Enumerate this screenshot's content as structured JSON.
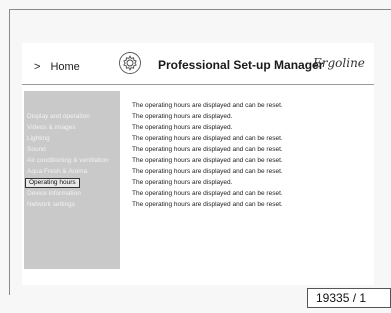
{
  "header": {
    "back_glyph": ">",
    "home_label": "Home",
    "title": "Professional Set-up Manager",
    "brand": "Ergoline",
    "gear_icon": "gear-icon"
  },
  "sidebar": {
    "items": [
      {
        "label": "Display and operation",
        "active": false
      },
      {
        "label": "Videos & images",
        "active": false
      },
      {
        "label": "Lighting",
        "active": false
      },
      {
        "label": "Sound",
        "active": false
      },
      {
        "label": "Air conditioning & ventilation",
        "active": false
      },
      {
        "label": "Aqua Fresh & Aroma",
        "active": false
      },
      {
        "label": "Operating hours",
        "active": true
      },
      {
        "label": "Device information",
        "active": false
      },
      {
        "label": "Network settings",
        "active": false
      }
    ]
  },
  "main": {
    "lines": [
      "The operating hours are displayed and can be reset.",
      "The operating hours are displayed.",
      "The operating hours are displayed.",
      "The operating hours are displayed and can be reset.",
      "The operating hours are displayed and can be reset.",
      "The operating hours are displayed and can be reset.",
      "The operating hours are displayed and can be reset.",
      "The operating hours are displayed.",
      "The operating hours are displayed and can be reset.",
      "The operating hours are displayed and can be reset."
    ]
  },
  "figure_ref": "19335 / 1",
  "colors": {
    "sidebar_bg": "#c9c9c9",
    "sidebar_text": "#f2f2f2",
    "screen_bg": "#ffffff"
  }
}
